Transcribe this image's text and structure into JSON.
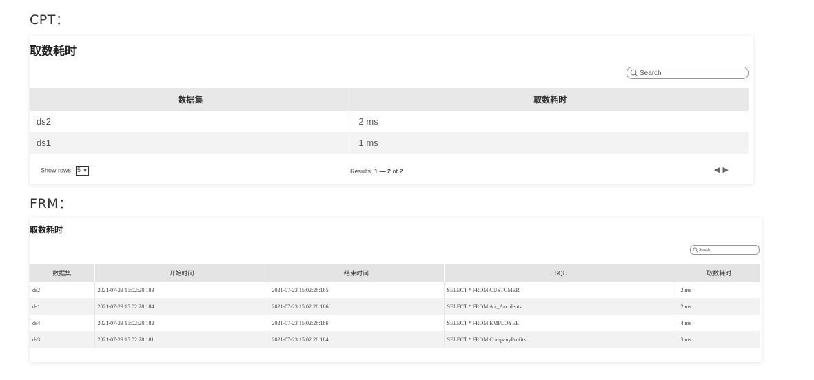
{
  "cpt": {
    "label": "CPT：",
    "title": "取数耗时",
    "search": {
      "placeholder": "Search"
    },
    "columns": [
      "数据集",
      "取数耗时"
    ],
    "rows": [
      [
        "ds2",
        "2 ms"
      ],
      [
        "ds1",
        "1 ms"
      ]
    ],
    "footer": {
      "show_rows_label": "Show rows:",
      "show_rows_value": "5",
      "results_prefix": "Results: ",
      "results_range": "1 — 2",
      "results_of": " of ",
      "results_total": "2",
      "prev": "◀",
      "next": "▶"
    }
  },
  "frm": {
    "label": "FRM：",
    "title": "取数耗时",
    "search": {
      "placeholder": "Search"
    },
    "columns": [
      "数据集",
      "开始时间",
      "结束时间",
      "SQL",
      "取数耗时"
    ],
    "rows": [
      [
        "ds2",
        "2021-07-23 15:02:28:183",
        "2021-07-23 15:02:28:185",
        "SELECT * FROM CUSTOMER",
        "2 ms"
      ],
      [
        "ds1",
        "2021-07-23 15:02:28:184",
        "2021-07-23 15:02:28:186",
        "SELECT * FROM Air_Accidents",
        "2 ms"
      ],
      [
        "ds4",
        "2021-07-23 15:02:28:182",
        "2021-07-23 15:02:28:186",
        "SELECT * FROM EMPLOYEE",
        "4 ms"
      ],
      [
        "ds3",
        "2021-07-23 15:02:28:181",
        "2021-07-23 15:02:28:184",
        "SELECT * FROM CompanyProfits",
        "3 ms"
      ]
    ]
  },
  "icons": {
    "search": "search-icon",
    "prev": "triangle-left-icon",
    "next": "triangle-right-icon"
  }
}
